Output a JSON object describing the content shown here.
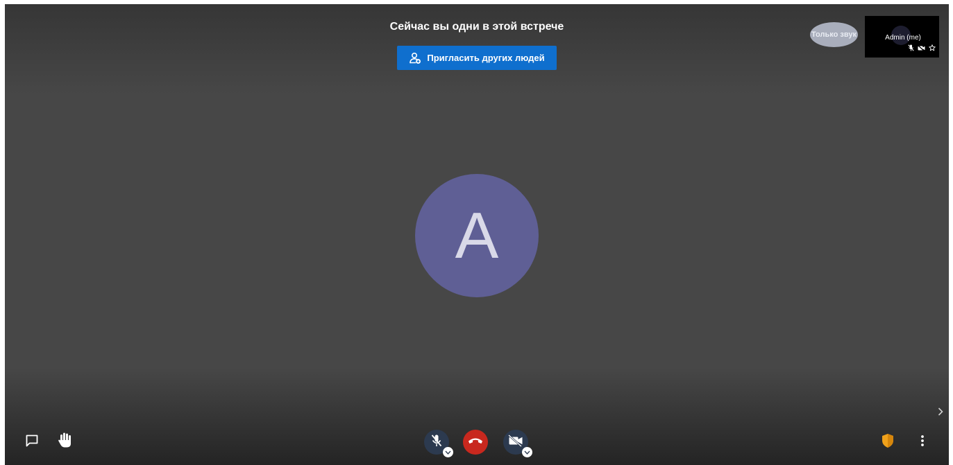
{
  "meeting": {
    "alone_message": "Сейчас вы одни в этой встрече",
    "invite_label": "Пригласить других людей",
    "avatar_letter": "A"
  },
  "filmstrip": {
    "audio_only_label": "Только звук",
    "self_name": "Admin (me)"
  },
  "toolbar": {
    "left": [
      "chat-icon",
      "raise-hand-icon"
    ],
    "center": [
      "microphone-muted-icon",
      "hangup-icon",
      "camera-off-icon"
    ],
    "right": [
      "security-shield-icon",
      "more-vertical-icon"
    ]
  },
  "colors": {
    "background": "#474747",
    "invite_button": "#0f6fce",
    "avatar": "#5f5f95",
    "hangup": "#c8281e",
    "media_button": "#2c3a4f",
    "security_shield": "#f0a21b"
  }
}
